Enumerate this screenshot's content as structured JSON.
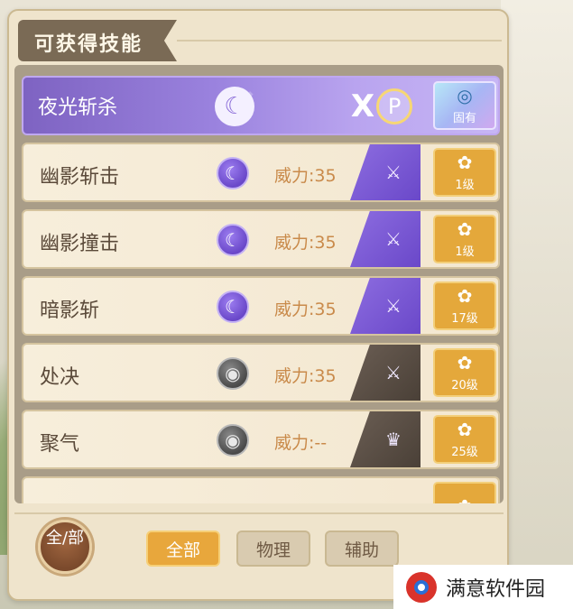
{
  "panel": {
    "title": "可获得技能"
  },
  "skills": [
    {
      "name": "夜光斩杀",
      "featured": true,
      "badge_label": "固有",
      "badge_icon": "swirl-icon"
    },
    {
      "name": "幽影斩击",
      "type_icon": "moon",
      "power": "威力:35",
      "tail": "purple",
      "tail_icon": "sword-icon",
      "level": "1级"
    },
    {
      "name": "幽影撞击",
      "type_icon": "moon",
      "power": "威力:35",
      "tail": "purple",
      "tail_icon": "sword-icon",
      "level": "1级"
    },
    {
      "name": "暗影斩",
      "type_icon": "moon",
      "power": "威力:35",
      "tail": "purple",
      "tail_icon": "sword-icon",
      "level": "17级"
    },
    {
      "name": "处决",
      "type_icon": "gray",
      "power": "威力:35",
      "tail": "dark",
      "tail_icon": "sword-icon",
      "level": "20级"
    },
    {
      "name": "聚气",
      "type_icon": "gray",
      "power": "威力:--",
      "tail": "dark",
      "tail_icon": "crown-icon",
      "level": "25级"
    }
  ],
  "filter": {
    "all_circle_label": "全/部",
    "tabs": [
      {
        "label": "全部",
        "active": true
      },
      {
        "label": "物理",
        "active": false
      },
      {
        "label": "辅助",
        "active": false
      }
    ]
  },
  "watermark": {
    "text": "满意软件园"
  },
  "colors": {
    "accent_orange": "#e8a73c",
    "purple": "#7e63c2",
    "power_text": "#c98a4a"
  }
}
